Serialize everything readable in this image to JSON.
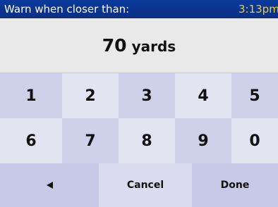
{
  "header": {
    "title": "Warn when closer than:",
    "time": "3:13pm"
  },
  "display": {
    "value": "70",
    "unit": "yards"
  },
  "keypad": {
    "row1": [
      "1",
      "2",
      "3",
      "4",
      "5"
    ],
    "row2": [
      "6",
      "7",
      "8",
      "9",
      "0"
    ]
  },
  "actions": {
    "back_icon": "left-arrow-icon",
    "cancel_label": "Cancel",
    "done_label": "Done"
  },
  "colors": {
    "header_bg": "#0a3a9b",
    "header_text": "#ffffff",
    "clock_text": "#f2d21b",
    "key_dark": "#cfd1ea",
    "key_light": "#e3e4f2"
  }
}
